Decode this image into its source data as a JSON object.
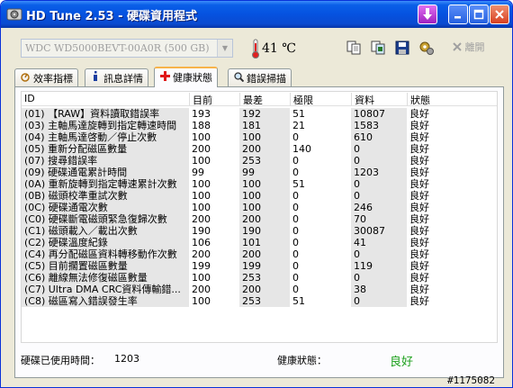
{
  "window": {
    "title": "HD Tune 2.53 - 硬碟資用程式"
  },
  "toolbar": {
    "drive": "WDC WD5000BEVT-00A0R (500 GB)",
    "temperature": "41 ℃",
    "exit_label": "離開"
  },
  "tabs": [
    {
      "label": "效率指標",
      "icon": "gauge-icon"
    },
    {
      "label": "訊息詳情",
      "icon": "info-icon"
    },
    {
      "label": "健康狀態",
      "icon": "health-cross-icon"
    },
    {
      "label": "錯誤掃描",
      "icon": "magnifier-icon"
    }
  ],
  "active_tab": 2,
  "table": {
    "headers": [
      "ID",
      "目前",
      "最差",
      "極限",
      "資料",
      "狀態"
    ],
    "rows": [
      [
        "(01) 【RAW】資料讀取錯誤率",
        "193",
        "192",
        "51",
        "10807",
        "良好"
      ],
      [
        "(03) 主軸馬達旋轉到指定轉速時間",
        "188",
        "181",
        "21",
        "1583",
        "良好"
      ],
      [
        "(04) 主軸馬達啓動／停止次數",
        "100",
        "100",
        "0",
        "610",
        "良好"
      ],
      [
        "(05) 重新分配磁區數量",
        "200",
        "200",
        "140",
        "0",
        "良好"
      ],
      [
        "(07) 搜尋錯誤率",
        "100",
        "253",
        "0",
        "0",
        "良好"
      ],
      [
        "(09) 硬碟通電累計時間",
        "99",
        "99",
        "0",
        "1203",
        "良好"
      ],
      [
        "(0A) 重新旋轉到指定轉速累計次數",
        "100",
        "100",
        "51",
        "0",
        "良好"
      ],
      [
        "(0B) 磁頭校準重試次數",
        "100",
        "100",
        "0",
        "0",
        "良好"
      ],
      [
        "(0C) 硬碟通電次數",
        "100",
        "100",
        "0",
        "246",
        "良好"
      ],
      [
        "(C0) 硬碟斷電磁頭緊急復歸次數",
        "200",
        "200",
        "0",
        "70",
        "良好"
      ],
      [
        "(C1) 磁頭載入／載出次數",
        "190",
        "190",
        "0",
        "30087",
        "良好"
      ],
      [
        "(C2) 硬碟溫度紀錄",
        "106",
        "101",
        "0",
        "41",
        "良好"
      ],
      [
        "(C4) 再分配磁區資料轉移動作次數",
        "200",
        "200",
        "0",
        "0",
        "良好"
      ],
      [
        "(C5) 目前擱置磁區數量",
        "199",
        "199",
        "0",
        "119",
        "良好"
      ],
      [
        "(C6) 離線無法修復磁區數量",
        "100",
        "253",
        "0",
        "0",
        "良好"
      ],
      [
        "(C7) Ultra DMA CRC資料傳輸錯...",
        "200",
        "200",
        "0",
        "38",
        "良好"
      ],
      [
        "(C8) 磁區寫入錯誤發生率",
        "100",
        "253",
        "51",
        "0",
        "良好"
      ]
    ]
  },
  "status": {
    "power_on_label": "硬碟已使用時間：",
    "power_on_value": "1203",
    "health_label": "健康狀態：",
    "health_value": "良好"
  },
  "watermark": "#1175082",
  "colors": {
    "titlebar": "#0552e0",
    "health_good": "#1ca01c",
    "tab_highlight": "#f7b34a"
  }
}
